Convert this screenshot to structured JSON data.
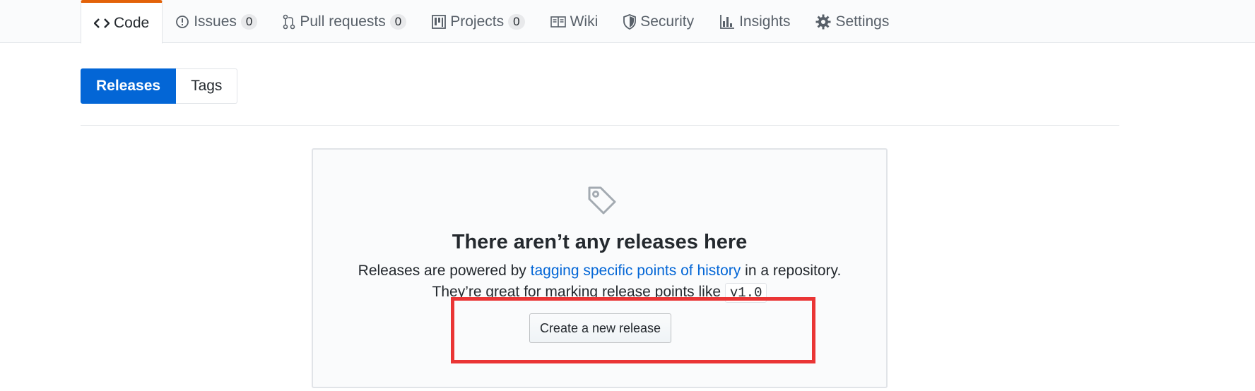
{
  "reponav": {
    "items": [
      {
        "label": "Code",
        "icon": "code-icon",
        "selected": true
      },
      {
        "label": "Issues",
        "icon": "issue-opened-icon",
        "count": "0"
      },
      {
        "label": "Pull requests",
        "icon": "git-pull-request-icon",
        "count": "0"
      },
      {
        "label": "Projects",
        "icon": "project-icon",
        "count": "0"
      },
      {
        "label": "Wiki",
        "icon": "book-icon"
      },
      {
        "label": "Security",
        "icon": "shield-icon"
      },
      {
        "label": "Insights",
        "icon": "graph-icon"
      },
      {
        "label": "Settings",
        "icon": "gear-icon"
      }
    ],
    "selected_border_color": "#e36209"
  },
  "subnav": {
    "releases_label": "Releases",
    "tags_label": "Tags"
  },
  "blankslate": {
    "icon": "tag-icon",
    "title": "There aren’t any releases here",
    "line1_before": "Releases are powered by ",
    "line1_link": "tagging specific points of history",
    "line1_after": " in a repository.",
    "line2_before": "They’re great for marking release points like ",
    "line2_code": "v1.0",
    "button_label": "Create a new release"
  },
  "colors": {
    "accent": "#0366d6",
    "highlight": "#ea3535"
  }
}
